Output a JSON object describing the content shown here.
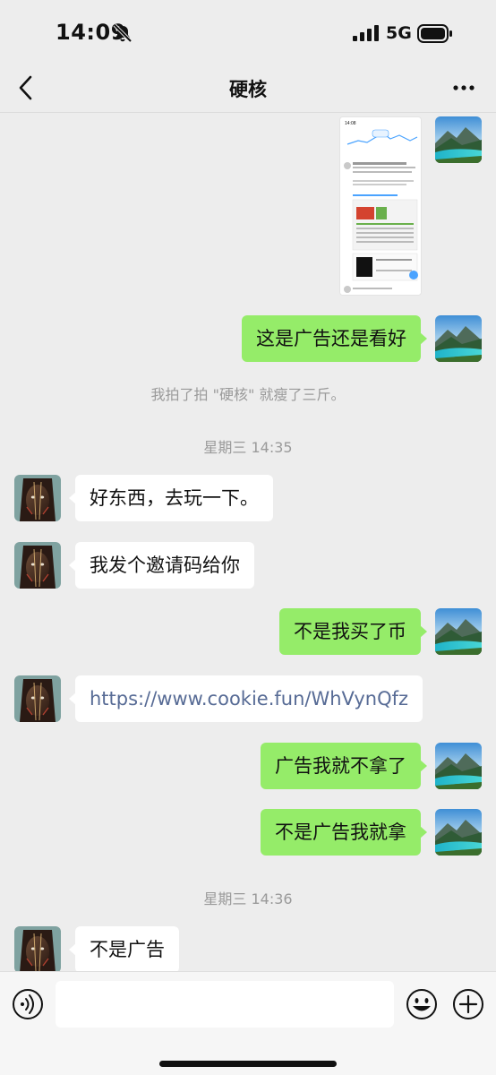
{
  "status_bar": {
    "time": "14:09",
    "network": "5G"
  },
  "header": {
    "title": "硬核"
  },
  "messages": [
    {
      "id": "m1",
      "side": "me",
      "type": "image",
      "preview_time": "14:08"
    },
    {
      "id": "m2",
      "side": "me",
      "text": "这是广告还是看好"
    },
    {
      "id": "s1",
      "type": "system",
      "text": "我拍了拍 \"硬核\" 就瘦了三斤。"
    },
    {
      "id": "t1",
      "type": "timestamp",
      "text": "星期三 14:35"
    },
    {
      "id": "m3",
      "side": "peer",
      "text": "好东西，去玩一下。"
    },
    {
      "id": "m4",
      "side": "peer",
      "text": "我发个邀请码给你"
    },
    {
      "id": "m5",
      "side": "me",
      "text": "不是我买了币"
    },
    {
      "id": "m6",
      "side": "peer",
      "text": "https://www.cookie.fun/WhVynQfz",
      "link": true
    },
    {
      "id": "m7",
      "side": "me",
      "text": "广告我就不拿了"
    },
    {
      "id": "m8",
      "side": "me",
      "text": "不是广告我就拿"
    },
    {
      "id": "t2",
      "type": "timestamp",
      "text": "星期三 14:36"
    },
    {
      "id": "m9",
      "side": "peer",
      "text": "不是广告"
    }
  ],
  "input": {
    "placeholder": "",
    "value": ""
  },
  "icons": {
    "back": "chevron-left-icon",
    "more": "more-icon",
    "voice": "voice-icon",
    "emoji": "emoji-icon",
    "plus": "plus-icon"
  },
  "colors": {
    "my_bubble": "#95ec69",
    "peer_bubble": "#ffffff",
    "background": "#ededed",
    "link": "#576b95"
  }
}
